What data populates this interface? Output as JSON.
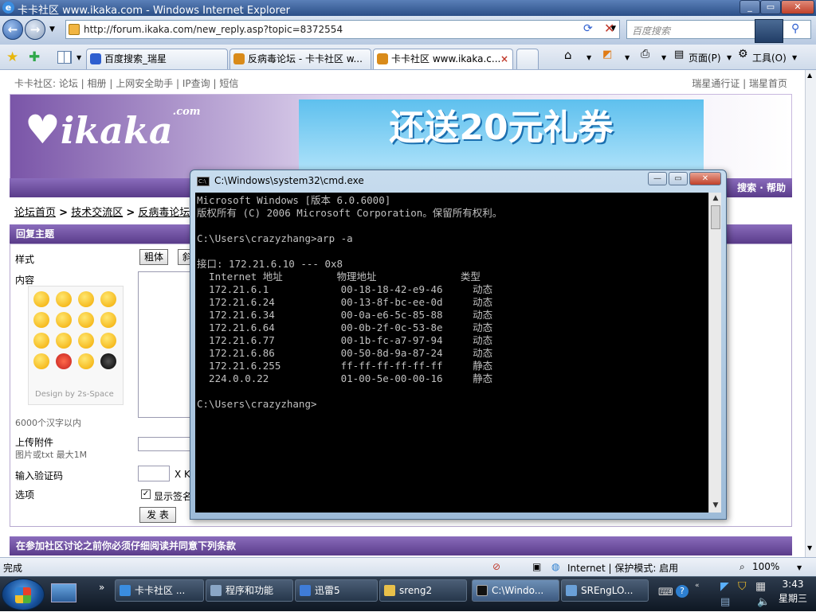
{
  "window": {
    "title": "卡卡社区 www.ikaka.com - Windows Internet Explorer",
    "minimize": "_",
    "maximize": "▭",
    "close": "✕"
  },
  "address": {
    "url": "http://forum.ikaka.com/new_reply.asp?topic=8372554",
    "search_placeholder": "百度搜索"
  },
  "tabs": [
    {
      "label": "百度搜索_瑞星",
      "fav_color": "#2d5ecf"
    },
    {
      "label": "反病毒论坛 - 卡卡社区 w...",
      "fav_color": "#d98b1a"
    },
    {
      "label": "卡卡社区 www.ikaka.c...",
      "fav_color": "#d98b1a"
    }
  ],
  "toolbar": {
    "page": "页面(P)",
    "tools": "工具(O)"
  },
  "site": {
    "topnav": "卡卡社区: 论坛 | 相册 | 上网安全助手 | IP查询 | 短信",
    "toplinks": "瑞星通行证 | 瑞星首页",
    "logo": "ikaka",
    "logo_com": ".com",
    "ad_text": "还送20元礼券",
    "purplebar": "搜索 · 帮助",
    "crumbs": [
      "论坛首页",
      "技术交流区",
      "反病毒论坛"
    ],
    "crumb_sep": ">",
    "reply_header": "回复主题",
    "labels": {
      "style": "样式",
      "content": "内容",
      "limit": "6000个汉字以内",
      "upload": "上传附件",
      "upload_note": "图片或txt 最大1M",
      "captcha": "输入验证码",
      "options": "选项"
    },
    "bold_btn": "粗体",
    "italic_btn": "斜",
    "smiley_credit": "Design by 2s-Space",
    "captcha_hint": "X K",
    "show_sign": "显示签名",
    "submit_btn": "发 表",
    "terms_header": "在参加社区讨论之前你必须仔细阅读并同意下列条款"
  },
  "cmd": {
    "title": "C:\\Windows\\system32\\cmd.exe",
    "icon": "C:\\",
    "lines": [
      "Microsoft Windows [版本 6.0.6000]",
      "版权所有 (C) 2006 Microsoft Corporation。保留所有权利。",
      "",
      "C:\\Users\\crazyzhang>arp -a",
      "",
      "接口: 172.21.6.10 --- 0x8",
      "  Internet 地址         物理地址              类型",
      "  172.21.6.1            00-18-18-42-e9-46     动态",
      "  172.21.6.24           00-13-8f-bc-ee-0d     动态",
      "  172.21.6.34           00-0a-e6-5c-85-88     动态",
      "  172.21.6.64           00-0b-2f-0c-53-8e     动态",
      "  172.21.6.77           00-1b-fc-a7-97-94     动态",
      "  172.21.6.86           00-50-8d-9a-87-24     动态",
      "  172.21.6.255          ff-ff-ff-ff-ff-ff     静态",
      "  224.0.0.22            01-00-5e-00-00-16     静态",
      "",
      "C:\\Users\\crazyzhang>"
    ]
  },
  "statusbar": {
    "left": "完成",
    "zone": "Internet | 保护模式: 启用",
    "zoom": "100%"
  },
  "taskbar": {
    "items": [
      {
        "label": "卡卡社区 ...",
        "color": "#3a8de0"
      },
      {
        "label": "程序和功能",
        "color": "#8aa6c6"
      },
      {
        "label": "迅雷5",
        "color": "#3f7cd8"
      },
      {
        "label": "sreng2",
        "color": "#e8c04a"
      },
      {
        "label": "C:\\Windo...",
        "color": "#111111"
      },
      {
        "label": "SREngLO...",
        "color": "#6aa0d8"
      }
    ],
    "time": "3:43",
    "day": "星期三"
  }
}
